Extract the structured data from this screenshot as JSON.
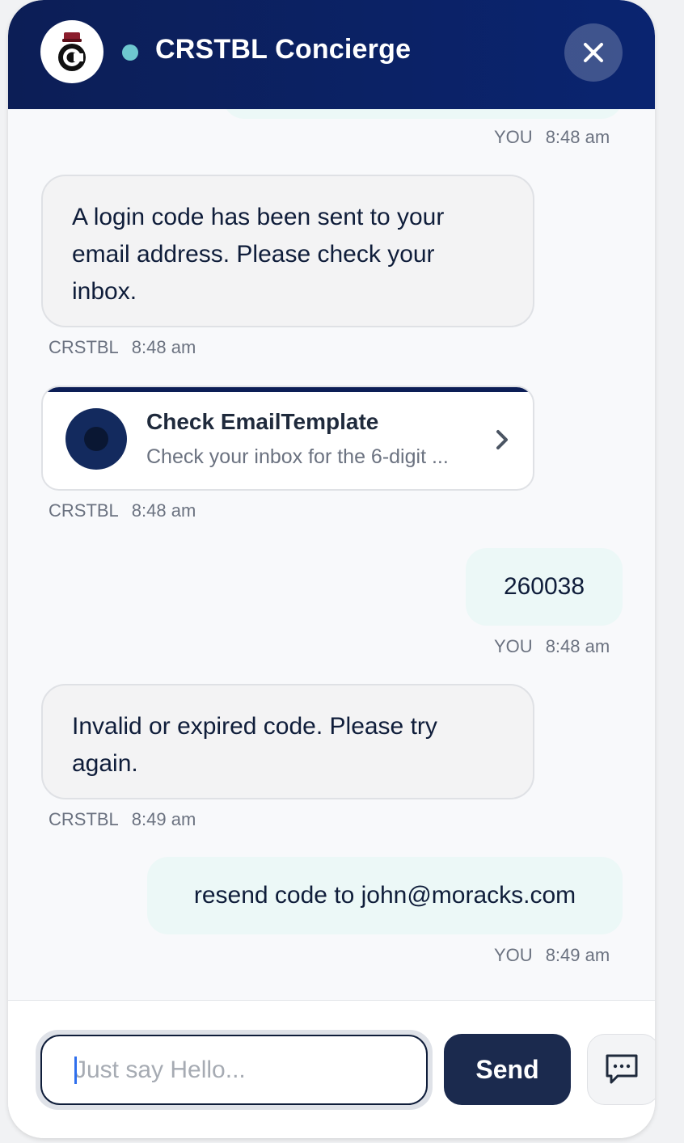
{
  "header": {
    "title": "CRSTBL Concierge",
    "logo_icon": "concierge-bellhop-c-logo",
    "status": "online",
    "status_color": "#6ec7cf",
    "close_icon": "close-x-icon"
  },
  "messages": [
    {
      "sender": "user",
      "who": "YOU",
      "time": "8:48 am"
    },
    {
      "sender": "bot",
      "who": "CRSTBL",
      "time": "8:48 am",
      "text": "A login code has been sent to your email address. Please check your inbox."
    },
    {
      "sender": "bot",
      "type": "card",
      "who": "CRSTBL",
      "time": "8:48 am",
      "card": {
        "title": "Check EmailTemplate",
        "subtitle": "Check your inbox for the 6-digit ..."
      }
    },
    {
      "sender": "user",
      "who": "YOU",
      "time": "8:48 am",
      "text": "260038"
    },
    {
      "sender": "bot",
      "who": "CRSTBL",
      "time": "8:49 am",
      "text": "Invalid or expired code. Please try again."
    },
    {
      "sender": "user",
      "who": "YOU",
      "time": "8:49 am",
      "text": "resend code to john@moracks.com"
    }
  ],
  "composer": {
    "placeholder": "Just say Hello...",
    "value": "",
    "send_label": "Send",
    "chat_icon": "chat-bubble-dots-icon"
  },
  "colors": {
    "header": "#0c1e56",
    "send_button": "#1b2a4e",
    "user_bubble": "#ecf8f7",
    "bot_bubble": "#f3f3f4"
  }
}
